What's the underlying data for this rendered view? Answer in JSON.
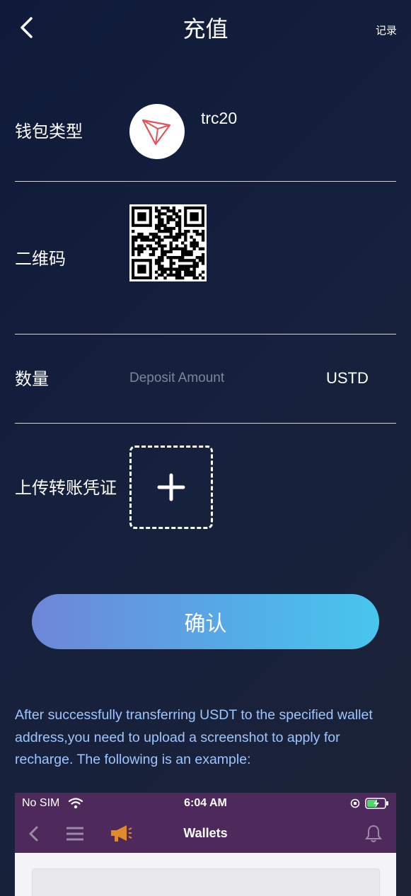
{
  "header": {
    "title": "充值",
    "record_label": "记录"
  },
  "wallet_type": {
    "label": "钱包类型",
    "coin_name": "trc20",
    "coin_color": "#e0545a"
  },
  "qr": {
    "label": "二维码"
  },
  "amount": {
    "label": "数量",
    "placeholder": "Deposit Amount",
    "unit": "USTD"
  },
  "upload": {
    "label": "上传转账凭证"
  },
  "confirm_label": "确认",
  "instructions": "After successfully transferring USDT to the specified wallet address,you need to upload a screenshot to apply for recharge. The following is an example:",
  "example_screenshot": {
    "carrier": "No SIM",
    "time": "6:04 AM",
    "nav_title": "Wallets",
    "bar_color": "#4d2a5b",
    "megaphone_color": "#e08a2c"
  },
  "colors": {
    "background": "#141e3a",
    "instruction_text": "#9ec5ff",
    "button_gradient_start": "#6f86d8",
    "button_gradient_end": "#47c6ee"
  }
}
